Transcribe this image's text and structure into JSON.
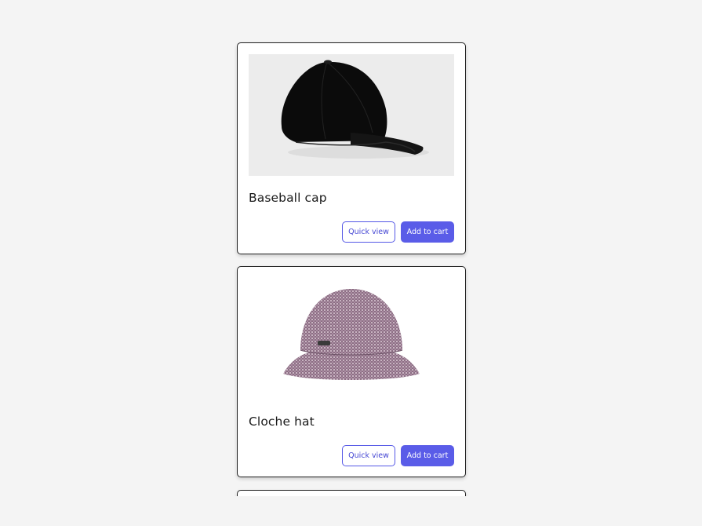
{
  "products": [
    {
      "name": "Baseball cap",
      "image_icon": "baseball-cap-image",
      "quick_view_label": "Quick view",
      "add_to_cart_label": "Add to cart"
    },
    {
      "name": "Cloche hat",
      "image_icon": "cloche-hat-image",
      "quick_view_label": "Quick view",
      "add_to_cart_label": "Add to cart"
    }
  ],
  "colors": {
    "page_background": "#f4f4f4",
    "card_background": "#ffffff",
    "accent": "#5a5ce8"
  }
}
